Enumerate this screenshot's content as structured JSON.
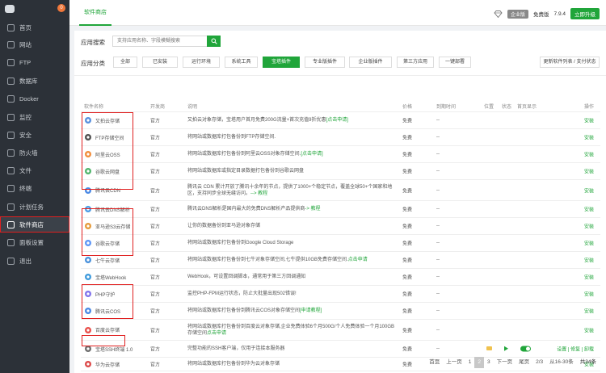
{
  "sidebar": {
    "badge": "0",
    "items": [
      {
        "label": "首页",
        "name": "sidebar-item-home"
      },
      {
        "label": "网站",
        "name": "sidebar-item-website"
      },
      {
        "label": "FTP",
        "name": "sidebar-item-ftp"
      },
      {
        "label": "数据库",
        "name": "sidebar-item-database"
      },
      {
        "label": "Docker",
        "name": "sidebar-item-docker"
      },
      {
        "label": "监控",
        "name": "sidebar-item-monitor"
      },
      {
        "label": "安全",
        "name": "sidebar-item-security"
      },
      {
        "label": "防火墙",
        "name": "sidebar-item-firewall"
      },
      {
        "label": "文件",
        "name": "sidebar-item-files"
      },
      {
        "label": "终端",
        "name": "sidebar-item-terminal"
      },
      {
        "label": "计划任务",
        "name": "sidebar-item-cron"
      },
      {
        "label": "软件商店",
        "name": "sidebar-item-store"
      },
      {
        "label": "面板设置",
        "name": "sidebar-item-settings"
      },
      {
        "label": "退出",
        "name": "sidebar-item-logout"
      }
    ]
  },
  "topbar": {
    "tab": "软件商店",
    "enterprise_badge": "企业版",
    "edition": "免费版",
    "version": "7.9.4",
    "upgrade": "立即升级"
  },
  "search": {
    "label": "应用搜索",
    "placeholder": "支持应用名称、字段模糊搜索"
  },
  "category": {
    "label": "应用分类",
    "buttons": [
      "全部",
      "已安装",
      "运行环境",
      "系统工具",
      "宝塔插件",
      "专业版插件",
      "企业版插件",
      "第三方应用",
      "一键部署"
    ],
    "active": "宝塔插件",
    "refresh": "更新软件列表 / 支付状态"
  },
  "table": {
    "headers": {
      "name": "软件名称",
      "developer": "开发商",
      "desc": "说明",
      "price": "价格",
      "expire": "到期时间",
      "position": "位置",
      "status": "状态",
      "home": "首页显示",
      "action": "操作"
    },
    "rows": [
      {
        "name": "又拍云存储",
        "dev": "官方",
        "desc": "又拍云对象存储，宝塔用户首月免费200G流量+首次充值9折优惠",
        "link": "[点击申请]",
        "price": "免费",
        "expire": "--",
        "action": "安装"
      },
      {
        "name": "FTP存储空间",
        "dev": "官方",
        "desc": "将网站或数据库打包备份到FTP存储空间.",
        "link": "",
        "price": "免费",
        "expire": "--",
        "action": "安装"
      },
      {
        "name": "阿里云OSS",
        "dev": "官方",
        "desc": "将网站或数据库打包备份到阿里云OSS对象存储空间.",
        "link": "[点击申请]",
        "price": "免费",
        "expire": "--",
        "action": "安装"
      },
      {
        "name": "谷歌云网盘",
        "dev": "官方",
        "desc": "将网站或数据库或指定目录数据打包备份到谷歌云网盘",
        "link": "",
        "price": "免费",
        "expire": "--",
        "action": "安装"
      },
      {
        "name": "腾讯云CDN",
        "dev": "官方",
        "desc": "腾讯云 CDN 累计开放了腾讯十余年的节点，提供了1000+个稳定节点，覆盖全球50+个国家和地区，支持同步全球无缝访问。",
        "link": "--> 教程",
        "price": "免费",
        "expire": "--",
        "action": "安装"
      },
      {
        "name": "腾讯云DNS解析",
        "dev": "官方",
        "desc": "腾讯云DNS解析是国内最大的免费DNS解析产品提供商",
        "link": "-> 教程",
        "price": "免费",
        "expire": "--",
        "action": "安装"
      },
      {
        "name": "亚马逊S3云存储",
        "dev": "官方",
        "desc": "让你的数据备份到亚马逊对象存储",
        "link": "",
        "price": "免费",
        "expire": "--",
        "action": "安装"
      },
      {
        "name": "谷歌云存储",
        "dev": "官方",
        "desc": "将网站或数据库打包备份到Google Cloud Storage",
        "link": "",
        "price": "免费",
        "expire": "--",
        "action": "安装"
      },
      {
        "name": "七牛云存储",
        "dev": "官方",
        "desc": "将网站或数据库打包备份到七牛对象存储空间,七牛提供10GB免费存储空间.",
        "link": "点击申请",
        "price": "免费",
        "expire": "--",
        "action": "安装"
      },
      {
        "name": "宝塔WebHook",
        "dev": "官方",
        "desc": "WebHook，可设置回调脚本，通常用于第三方回调通知",
        "link": "",
        "price": "免费",
        "expire": "--",
        "action": "安装"
      },
      {
        "name": "PHP守护",
        "dev": "官方",
        "desc": "监控PHP-FPM运行状态，防止大批量出现502错误!",
        "link": "",
        "price": "免费",
        "expire": "--",
        "action": "安装"
      },
      {
        "name": "腾讯云COS",
        "dev": "官方",
        "desc": "将网站或数据库打包备份到腾讯云COS对象存储空间",
        "link": "[申请教程]",
        "price": "免费",
        "expire": "--",
        "action": "安装"
      },
      {
        "name": "百度云存储",
        "dev": "官方",
        "desc": "将网站或数据库打包备份到百度云对象存储,企业免费体验6个月500G/个人免费体验一个月100GB存储空间",
        "link": "点击申请",
        "price": "免费",
        "expire": "--",
        "action": "安装"
      },
      {
        "name": "宝塔SSH终端 1.0",
        "dev": "官方",
        "desc": "完整功能的SSH客户端，仅用于连接本服务器",
        "link": "",
        "price": "免费",
        "expire": "--",
        "action": "设置 | 修复 | 卸载"
      },
      {
        "name": "华为云存储",
        "dev": "官方",
        "desc": "将网站或数据库打包备份到华为云对象存储",
        "link": "",
        "price": "免费",
        "expire": "--",
        "action": "安装"
      }
    ]
  },
  "pager": {
    "first": "首页",
    "prev": "上一页",
    "p1": "1",
    "p2": "2",
    "p3": "3",
    "next": "下一页",
    "last": "尾页",
    "ratio": "2/3",
    "range": "从16-30条",
    "total": "共34条"
  },
  "icons": [
    "upyun-icon",
    "ftp-icon",
    "aliyun-icon",
    "google-drive-icon",
    "tencent-cdn-icon",
    "tencent-dns-icon",
    "aws-s3-icon",
    "google-cloud-icon",
    "qiniu-icon",
    "webhook-icon",
    "php-icon",
    "tencent-cos-icon",
    "baidu-cloud-icon",
    "ssh-icon",
    "huawei-cloud-icon"
  ],
  "colors": {
    "accent": "#20a53a",
    "sidebar": "#2c3138",
    "highlight": "#e02020"
  }
}
